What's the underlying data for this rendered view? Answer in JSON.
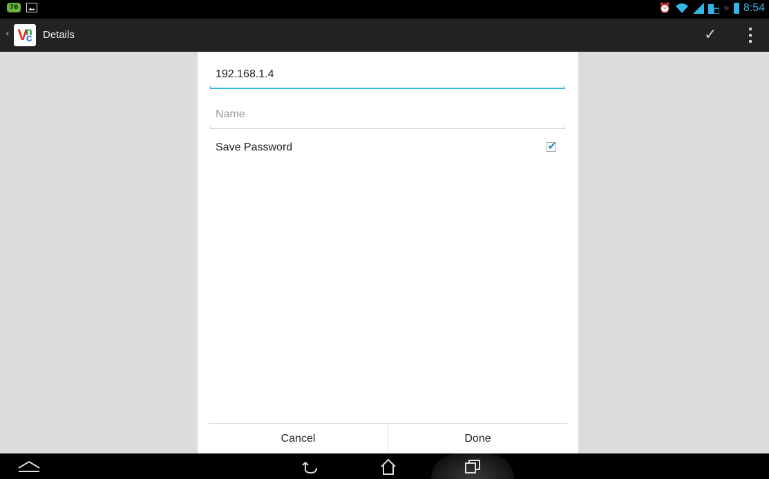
{
  "status_bar": {
    "notification_badge": "76",
    "time": "8:54",
    "accent_color": "#33b5e5"
  },
  "action_bar": {
    "app_icon_letters": {
      "v": "V",
      "n": "n",
      "c": "c"
    },
    "title": "Details",
    "confirm_icon": "checkmark-icon",
    "overflow_icon": "overflow-menu-icon"
  },
  "form": {
    "address_value": "192.168.1.4",
    "name_placeholder": "Name",
    "name_value": "",
    "save_password_label": "Save Password",
    "save_password_checked": true
  },
  "buttons": {
    "cancel": "Cancel",
    "done": "Done"
  },
  "nav_bar": {
    "icons": [
      "collapse-icon",
      "back-icon",
      "home-icon",
      "recents-icon"
    ]
  }
}
